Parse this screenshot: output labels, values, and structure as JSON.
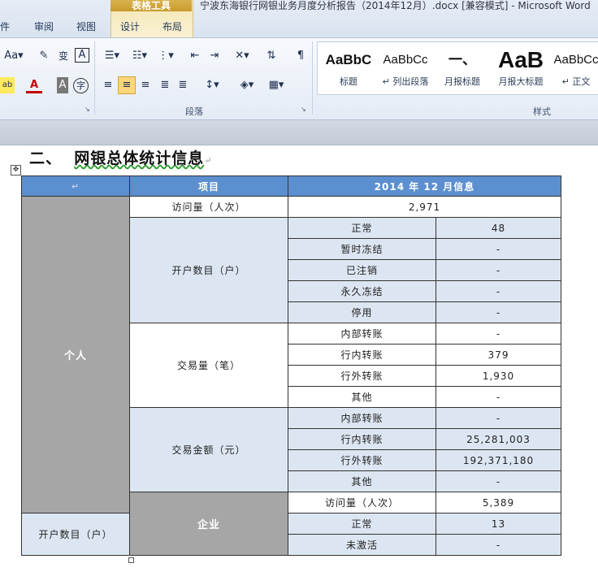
{
  "window": {
    "context_tab": "表格工具",
    "doc_title": "宁波东海银行网银业务月度分析报告（2014年12月）.docx [兼容模式] - Microsoft Word"
  },
  "tabs": [
    {
      "label": "件"
    },
    {
      "label": "审阅"
    },
    {
      "label": "视图"
    },
    {
      "label": "设计"
    },
    {
      "label": "布局"
    }
  ],
  "ribbon": {
    "font_group": {
      "change_case": "Aa",
      "clear_format": "A",
      "char_shading": "A",
      "enclose": "字",
      "font_color": "A",
      "highlight": "ab"
    },
    "paragraph_group_label": "段落",
    "styles_group_label": "样式",
    "styles": [
      {
        "sample": "AaBbC",
        "name": "标题"
      },
      {
        "sample": "AaBbCc",
        "name": "↵ 列出段落"
      },
      {
        "sample": "一、",
        "name": "月报标题"
      },
      {
        "sample": "AaB",
        "name": "月报大标题"
      },
      {
        "sample": "AaBbCc",
        "name": "↵ 正文"
      }
    ]
  },
  "document": {
    "heading_number": "二、",
    "heading_text": "网银总体统计信息",
    "para_mark": "↵"
  },
  "table": {
    "header": {
      "item": "项目",
      "info": "2014 年 12 月信息"
    },
    "personal": {
      "label": "个人",
      "visits": {
        "label": "访问量（人次）",
        "value": "2,971"
      },
      "accounts": {
        "label": "开户数目（户）",
        "rows": [
          {
            "name": "正常",
            "value": "48"
          },
          {
            "name": "暂时冻结",
            "value": "-"
          },
          {
            "name": "已注销",
            "value": "-"
          },
          {
            "name": "永久冻结",
            "value": "-"
          },
          {
            "name": "停用",
            "value": "-"
          }
        ]
      },
      "transactions": {
        "label": "交易量（笔）",
        "rows": [
          {
            "name": "内部转账",
            "value": "-"
          },
          {
            "name": "行内转账",
            "value": "379"
          },
          {
            "name": "行外转账",
            "value": "1,930"
          },
          {
            "name": "其他",
            "value": "-"
          }
        ]
      },
      "amounts": {
        "label": "交易金额（元）",
        "rows": [
          {
            "name": "内部转账",
            "value": "-"
          },
          {
            "name": "行内转账",
            "value": "25,281,003"
          },
          {
            "name": "行外转账",
            "value": "192,371,180"
          },
          {
            "name": "其他",
            "value": "-"
          }
        ]
      }
    },
    "enterprise": {
      "label": "企业",
      "visits": {
        "label": "访问量（人次）",
        "value": "5,389"
      },
      "accounts": {
        "label": "开户数目（户）",
        "rows": [
          {
            "name": "正常",
            "value": "13"
          },
          {
            "name": "未激活",
            "value": "-"
          }
        ]
      }
    }
  }
}
